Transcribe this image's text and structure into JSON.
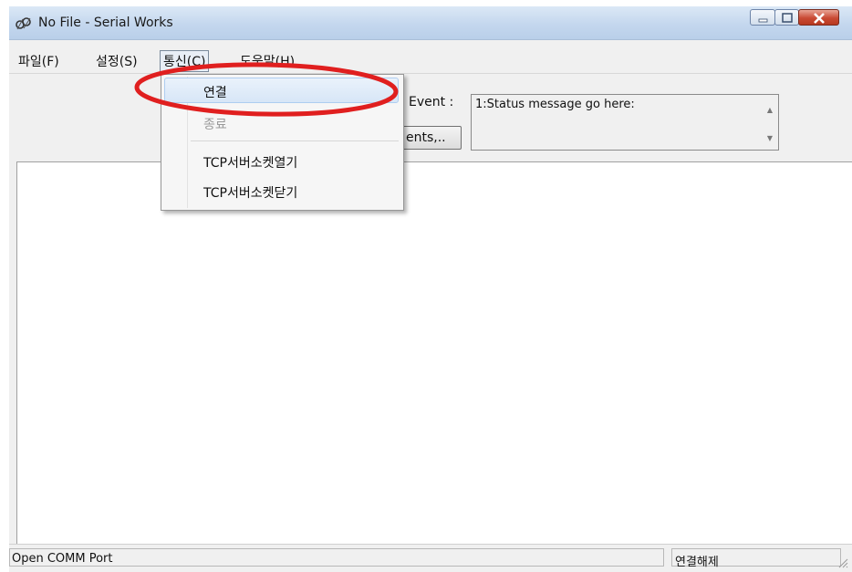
{
  "window": {
    "title": "No File - Serial Works"
  },
  "menubar": {
    "items": [
      "파일(F)",
      "설정(S)",
      "통신(C)",
      "도움말(H)"
    ]
  },
  "toolbar": {
    "event_label": "Event :",
    "events_button_label": "ents,..",
    "status_message": "1:Status message go here:"
  },
  "dropdown": {
    "connect": "연결",
    "close": "종료",
    "tcp_open": "TCP서버소켓열기",
    "tcp_close": "TCP서버소켓닫기"
  },
  "statusbar": {
    "left": "Open COMM Port",
    "right": "연결해제"
  },
  "colors": {
    "annotation_red": "#e01f1f",
    "titlebar": "#c4d7ee",
    "close_button": "#c94a34",
    "menu_highlight": "#d7e6f7"
  }
}
